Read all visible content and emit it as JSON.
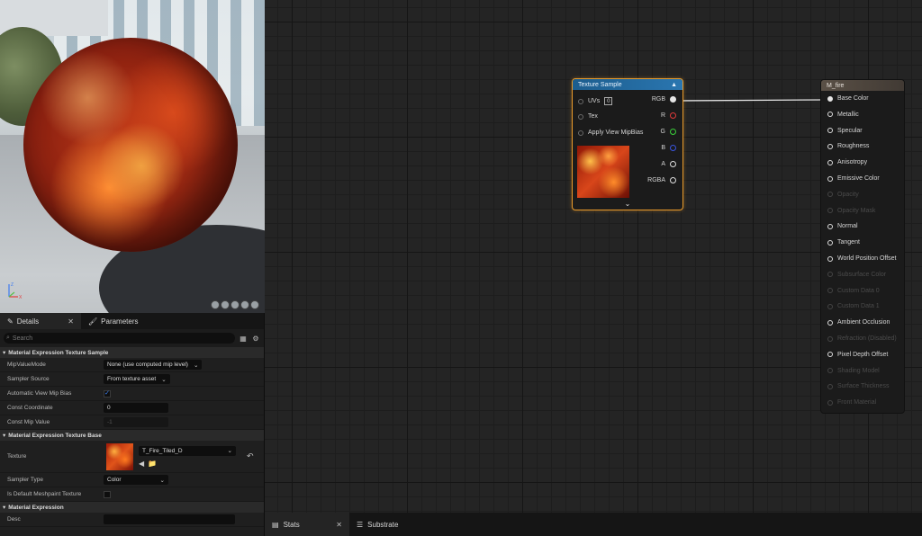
{
  "viewport": {
    "axis": {
      "x": "X",
      "y": "Y",
      "z": "Z"
    },
    "colors": {
      "x": "#e23b3b",
      "y": "#58c04a",
      "z": "#3d7bf0"
    }
  },
  "details": {
    "tabs": [
      {
        "label": "Details",
        "active": true
      },
      {
        "label": "Parameters",
        "active": false
      }
    ],
    "search_placeholder": "Search",
    "sections": {
      "texture_sample": {
        "title": "Material Expression Texture Sample",
        "mip_value_mode": {
          "label": "MipValueMode",
          "value": "None (use computed mip level)"
        },
        "sampler_source": {
          "label": "Sampler Source",
          "value": "From texture asset"
        },
        "auto_view_mip_bias": {
          "label": "Automatic View Mip Bias",
          "checked": true
        },
        "const_coordinate": {
          "label": "Const Coordinate",
          "value": "0"
        },
        "const_mip_value": {
          "label": "Const Mip Value",
          "value": "-1"
        }
      },
      "texture_base": {
        "title": "Material Expression Texture Base",
        "texture": {
          "label": "Texture",
          "value": "T_Fire_Tiled_D"
        },
        "sampler_type": {
          "label": "Sampler Type",
          "value": "Color"
        },
        "is_default_meshpaint": {
          "label": "Is Default Meshpaint Texture",
          "checked": false
        }
      },
      "material_expression": {
        "title": "Material Expression",
        "desc": {
          "label": "Desc",
          "value": ""
        }
      }
    }
  },
  "graph": {
    "texture_node": {
      "title": "Texture Sample",
      "inputs": [
        "UVs",
        "Tex",
        "Apply View MipBias"
      ],
      "uvs_value": "0",
      "outputs": [
        {
          "label": "RGB",
          "color": "#e6e6e6"
        },
        {
          "label": "R",
          "color": "#e03a3a"
        },
        {
          "label": "G",
          "color": "#3ad03a"
        },
        {
          "label": "B",
          "color": "#3a55e0"
        },
        {
          "label": "A",
          "color": "#dcdcdc"
        },
        {
          "label": "RGBA",
          "color": "#dcdcdc"
        }
      ]
    },
    "material_node": {
      "title": "M_fire",
      "pins": [
        {
          "label": "Base Color",
          "active": true,
          "connected": true
        },
        {
          "label": "Metallic",
          "active": true
        },
        {
          "label": "Specular",
          "active": true
        },
        {
          "label": "Roughness",
          "active": true
        },
        {
          "label": "Anisotropy",
          "active": true
        },
        {
          "label": "Emissive Color",
          "active": true
        },
        {
          "label": "Opacity",
          "active": false
        },
        {
          "label": "Opacity Mask",
          "active": false
        },
        {
          "label": "Normal",
          "active": true
        },
        {
          "label": "Tangent",
          "active": true
        },
        {
          "label": "World Position Offset",
          "active": true
        },
        {
          "label": "Subsurface Color",
          "active": false
        },
        {
          "label": "Custom Data 0",
          "active": false
        },
        {
          "label": "Custom Data 1",
          "active": false
        },
        {
          "label": "Ambient Occlusion",
          "active": true
        },
        {
          "label": "Refraction (Disabled)",
          "active": false
        },
        {
          "label": "Pixel Depth Offset",
          "active": true
        },
        {
          "label": "Shading Model",
          "active": false
        },
        {
          "label": "Surface Thickness",
          "active": false
        },
        {
          "label": "Front Material",
          "active": false
        }
      ]
    }
  },
  "bottom_tabs": [
    {
      "label": "Stats",
      "active": true
    },
    {
      "label": "Substrate",
      "active": false
    }
  ]
}
